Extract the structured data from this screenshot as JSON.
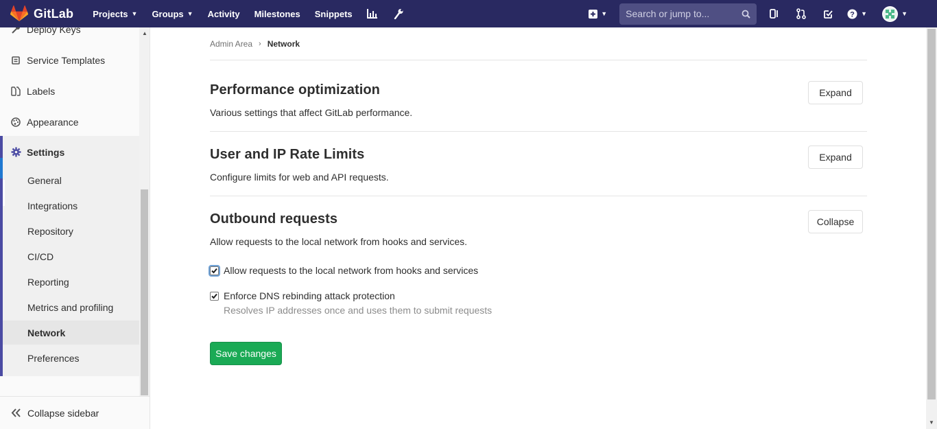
{
  "navbar": {
    "brand": "GitLab",
    "links": [
      {
        "label": "Projects",
        "dropdown": true
      },
      {
        "label": "Groups",
        "dropdown": true
      },
      {
        "label": "Activity",
        "dropdown": false
      },
      {
        "label": "Milestones",
        "dropdown": false
      },
      {
        "label": "Snippets",
        "dropdown": false
      }
    ],
    "icons": [
      "chart-icon",
      "wrench-icon",
      "plus-square-icon",
      "issues-icon",
      "merge-request-icon",
      "todo-icon",
      "help-icon"
    ],
    "search_placeholder": "Search or jump to...",
    "background": "#292961"
  },
  "sidebar": {
    "items": [
      {
        "label": "Deploy Keys",
        "icon": "key-icon"
      },
      {
        "label": "Service Templates",
        "icon": "template-icon"
      },
      {
        "label": "Labels",
        "icon": "labels-icon"
      },
      {
        "label": "Appearance",
        "icon": "palette-icon"
      }
    ],
    "settings_label": "Settings",
    "sub_items": [
      "General",
      "Integrations",
      "Repository",
      "CI/CD",
      "Reporting",
      "Metrics and profiling",
      "Network",
      "Preferences"
    ],
    "active_sub_item": "Network",
    "collapse_label": "Collapse sidebar"
  },
  "breadcrumb": {
    "parent": "Admin Area",
    "current": "Network"
  },
  "sections": [
    {
      "title": "Performance optimization",
      "description": "Various settings that affect GitLab performance.",
      "button": "Expand"
    },
    {
      "title": "User and IP Rate Limits",
      "description": "Configure limits for web and API requests.",
      "button": "Expand"
    },
    {
      "title": "Outbound requests",
      "description": "Allow requests to the local network from hooks and services.",
      "button": "Collapse"
    }
  ],
  "outbound": {
    "allow_local_label": "Allow requests to the local network from hooks and services",
    "allow_local_checked": true,
    "dns_label": "Enforce DNS rebinding attack protection",
    "dns_checked": true,
    "dns_help": "Resolves IP addresses once and uses them to submit requests",
    "save_label": "Save changes"
  },
  "colors": {
    "accent": "#1aaa55",
    "sidebar_active_border": "#4b4ba3",
    "navbar": "#292961"
  }
}
